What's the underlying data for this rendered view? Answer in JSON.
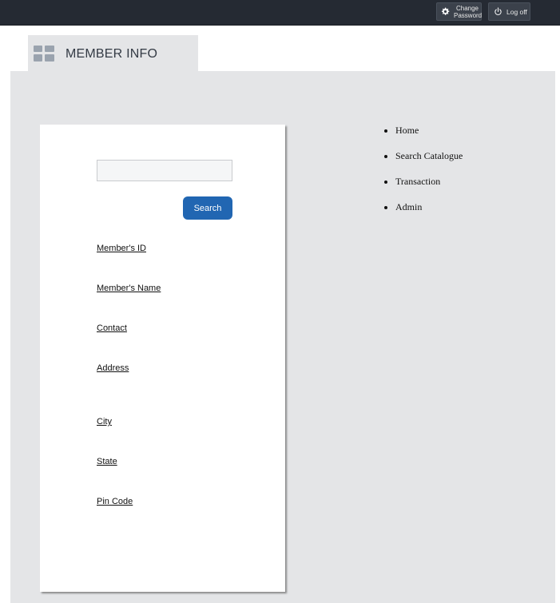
{
  "topbar": {
    "change_password_label": "Change Password",
    "change_password_icon": "gear-icon",
    "logoff_label": "Log off",
    "logoff_icon": "power-icon"
  },
  "tab": {
    "title": "MEMBER INFO",
    "icon": "grid-icon"
  },
  "search": {
    "input_value": "",
    "input_placeholder": "",
    "button_label": "Search"
  },
  "fields": {
    "member_id": "Member's ID",
    "member_name": "Member's Name",
    "contact": "Contact",
    "address": "Address",
    "city": "City",
    "state": "State",
    "pin_code": "Pin Code"
  },
  "nav": {
    "items": [
      "Home",
      "Search Catalogue",
      "Transaction",
      "Admin"
    ]
  },
  "colors": {
    "topbar_bg": "#252a33",
    "panel_bg": "#e4e5e7",
    "accent_button": "#2166b2"
  }
}
